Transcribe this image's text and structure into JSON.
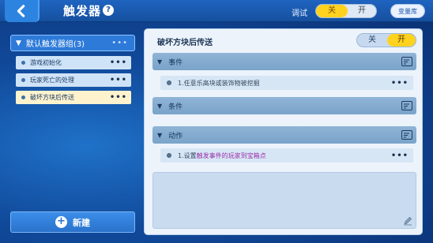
{
  "header": {
    "title": "触发器",
    "help_icon": "?",
    "debug_label": "调试",
    "debug_off": "关",
    "debug_on": "开",
    "variables_button": "变量库"
  },
  "sidebar": {
    "group_label": "默认触发器组(3)",
    "group_menu": "•••",
    "items": [
      {
        "label": "游戏初始化",
        "menu": "•••"
      },
      {
        "label": "玩家死亡的处理",
        "menu": "•••"
      },
      {
        "label": "破坏方块后传送",
        "menu": "•••"
      }
    ],
    "new_button": "新建",
    "new_icon": "+"
  },
  "detail": {
    "title": "破坏方块后传送",
    "toggle_off": "关",
    "toggle_on": "开",
    "sections": [
      {
        "label": "事件"
      },
      {
        "label": "条件"
      },
      {
        "label": "动作"
      }
    ],
    "event_entry": {
      "prefix": "1.任意乐高块或装饰物被挖掘",
      "menu": "•••"
    },
    "action_entry": {
      "prefix": "1.设置",
      "highlight": "触发事件的玩家到宝箱点",
      "menu": "•••"
    }
  },
  "colors": {
    "accent_yellow": "#ffd21f",
    "selected_item": "#fff3cd",
    "highlight_text": "#9a2fa8"
  },
  "icons": {
    "back": "chevron-left-icon",
    "help": "help-icon",
    "edit": "edit-list-icon",
    "pencil": "pencil-icon",
    "plus": "plus-icon"
  }
}
